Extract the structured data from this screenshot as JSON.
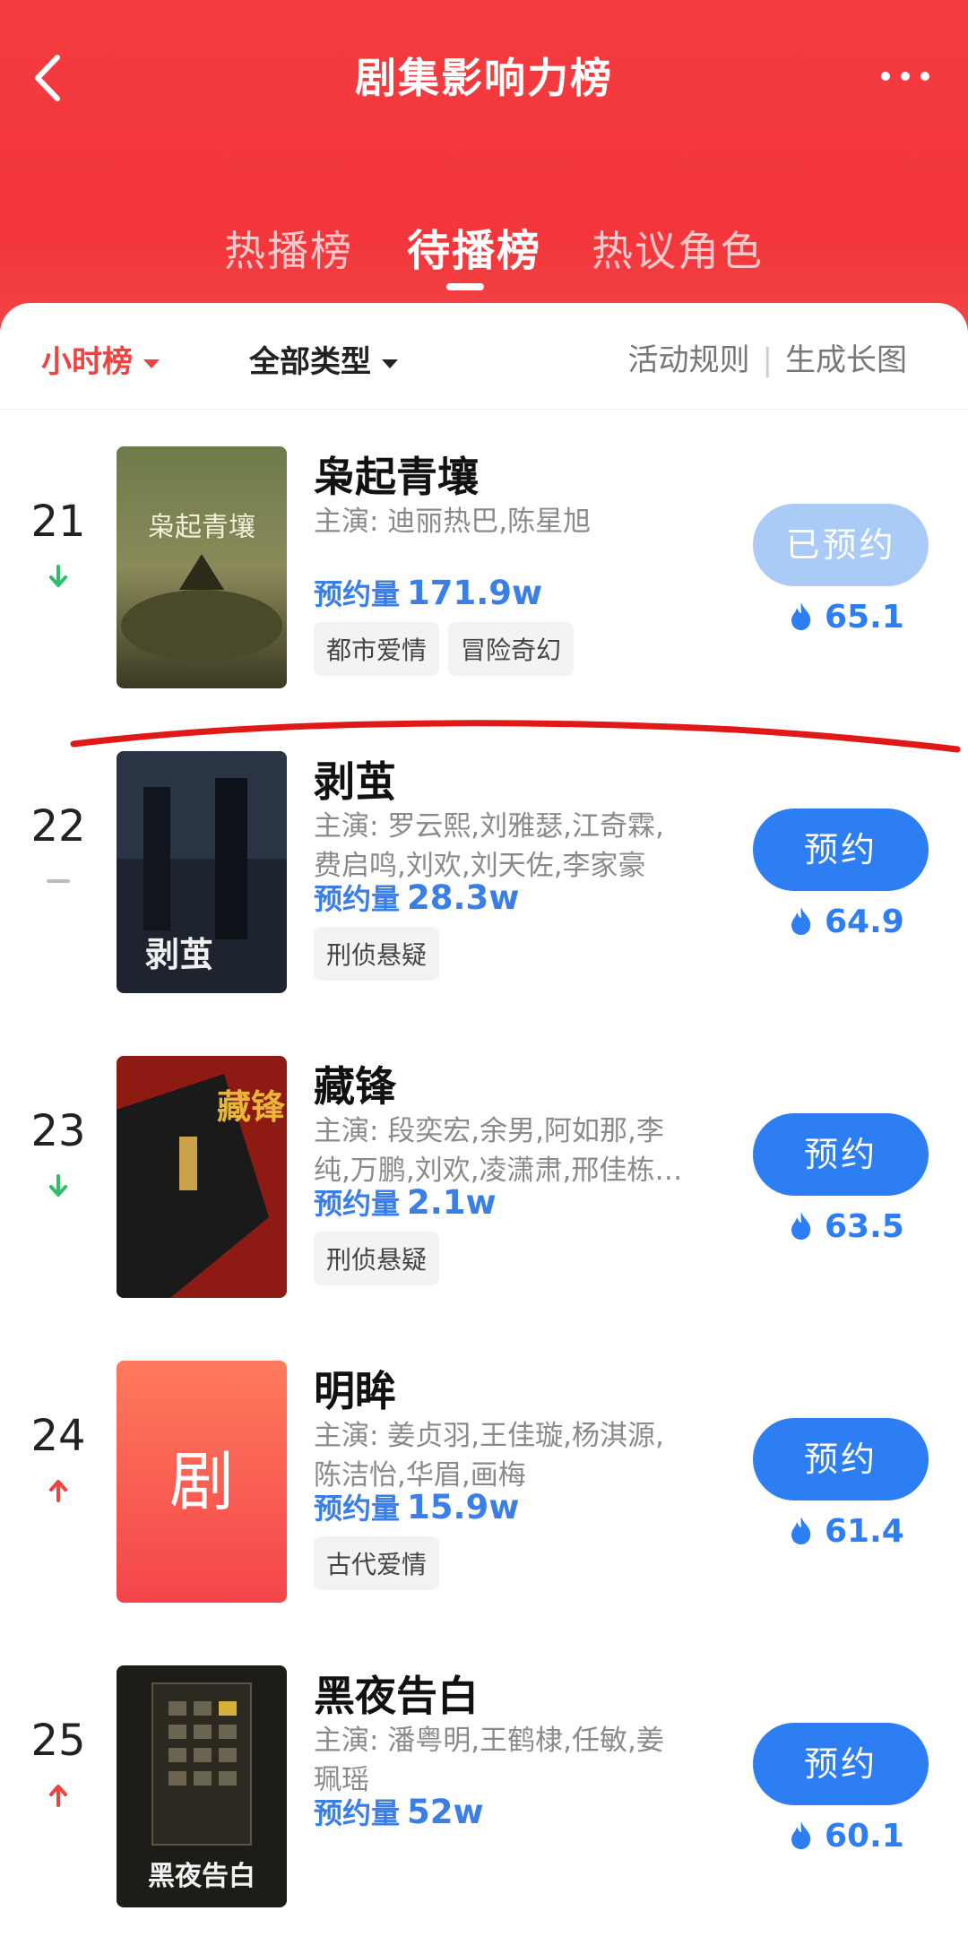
{
  "header": {
    "title": "剧集影响力榜",
    "tabs": [
      {
        "label": "热播榜"
      },
      {
        "label": "待播榜"
      },
      {
        "label": "热议角色"
      }
    ]
  },
  "filters": {
    "period": "小时榜",
    "category": "全部类型",
    "rules": "活动规则",
    "generate": "生成长图",
    "separator": "|"
  },
  "colors": {
    "brand_red": "#f3363b",
    "accent_blue": "#2d7ef3",
    "trend_down": "#2fbf6a",
    "trend_up": "#f0423f"
  },
  "items": [
    {
      "rank": "21",
      "trend": "down",
      "title": "枭起青壤",
      "cast": "主演: 迪丽热巴,陈星旭",
      "reserve_label": "预约量",
      "reserve_value": "171.9w",
      "tags": [
        "都市爱情",
        "冒险奇幻"
      ],
      "button": "已预约",
      "heat": "65.1",
      "poster_text": "枭起青壤"
    },
    {
      "rank": "22",
      "trend": "flat",
      "title": "剥茧",
      "cast": "主演: 罗云熙,刘雅瑟,江奇霖,费启鸣,刘欢,刘天佐,李家豪",
      "reserve_label": "预约量",
      "reserve_value": "28.3w",
      "tags": [
        "刑侦悬疑"
      ],
      "button": "预约",
      "heat": "64.9",
      "poster_text": "剥茧"
    },
    {
      "rank": "23",
      "trend": "down",
      "title": "藏锋",
      "cast": "主演: 段奕宏,余男,阿如那,李纯,万鹏,刘欢,凌潇肃,邢佳栋…",
      "reserve_label": "预约量",
      "reserve_value": "2.1w",
      "tags": [
        "刑侦悬疑"
      ],
      "button": "预约",
      "heat": "63.5",
      "poster_text": "藏锋"
    },
    {
      "rank": "24",
      "trend": "up",
      "title": "明眸",
      "cast": "主演: 姜贞羽,王佳璇,杨淇源,陈洁怡,华眉,画梅",
      "reserve_label": "预约量",
      "reserve_value": "15.9w",
      "tags": [
        "古代爱情"
      ],
      "button": "预约",
      "heat": "61.4",
      "poster_text": "剧"
    },
    {
      "rank": "25",
      "trend": "up",
      "title": "黑夜告白",
      "cast": "主演: 潘粤明,王鹤棣,任敏,姜珮瑶",
      "reserve_label": "预约量",
      "reserve_value": "52w",
      "tags": [],
      "button": "预约",
      "heat": "60.1",
      "poster_text": "黑夜告白"
    }
  ]
}
